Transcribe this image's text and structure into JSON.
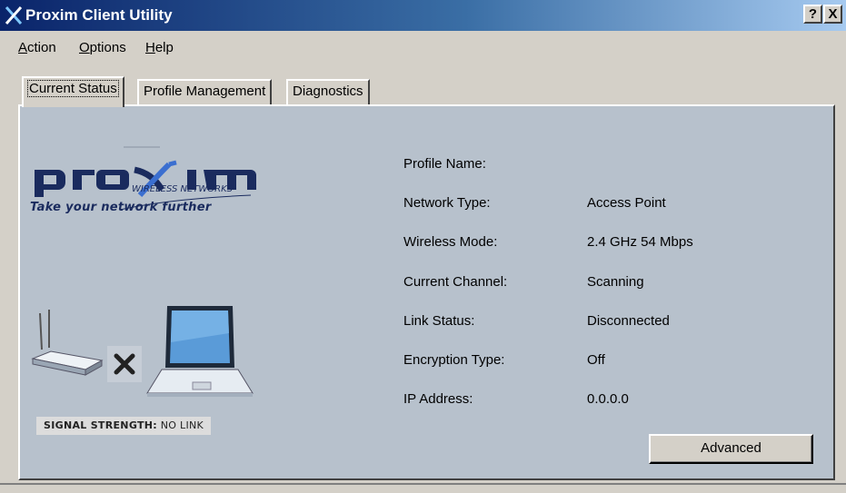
{
  "window": {
    "title": "Proxim Client Utility",
    "help_button": "?",
    "close_button": "X"
  },
  "menu": {
    "action": "Action",
    "options": "Options",
    "help": "Help"
  },
  "tabs": [
    {
      "label": "Current Status",
      "active": true
    },
    {
      "label": "Profile Management",
      "active": false
    },
    {
      "label": "Diagnostics",
      "active": false
    }
  ],
  "branding": {
    "logo_text": "proxim",
    "logo_subtitle": "WIRELESS NETWORKS",
    "tagline": "Take your network further"
  },
  "signal": {
    "label": "SIGNAL STRENGTH:",
    "value": "NO LINK"
  },
  "status_fields": [
    {
      "label": "Profile Name:",
      "value": ""
    },
    {
      "label": "Network Type:",
      "value": "Access Point"
    },
    {
      "label": "Wireless Mode:",
      "value": "2.4 GHz 54 Mbps"
    },
    {
      "label": "Current Channel:",
      "value": "Scanning"
    },
    {
      "label": "Link Status:",
      "value": "Disconnected"
    },
    {
      "label": "Encryption Type:",
      "value": "Off"
    },
    {
      "label": "IP Address:",
      "value": "0.0.0.0"
    }
  ],
  "advanced_button": "Advanced",
  "icons": [
    "proxim-app-icon",
    "wireless-router-icon",
    "no-link-x-icon",
    "laptop-icon"
  ],
  "colors": {
    "titlebar_start": "#0a246a",
    "titlebar_end": "#a6caf0",
    "panel_bg": "#b7c1cc",
    "logo_navy": "#1a2b5e",
    "logo_blue": "#3b6fd0"
  }
}
